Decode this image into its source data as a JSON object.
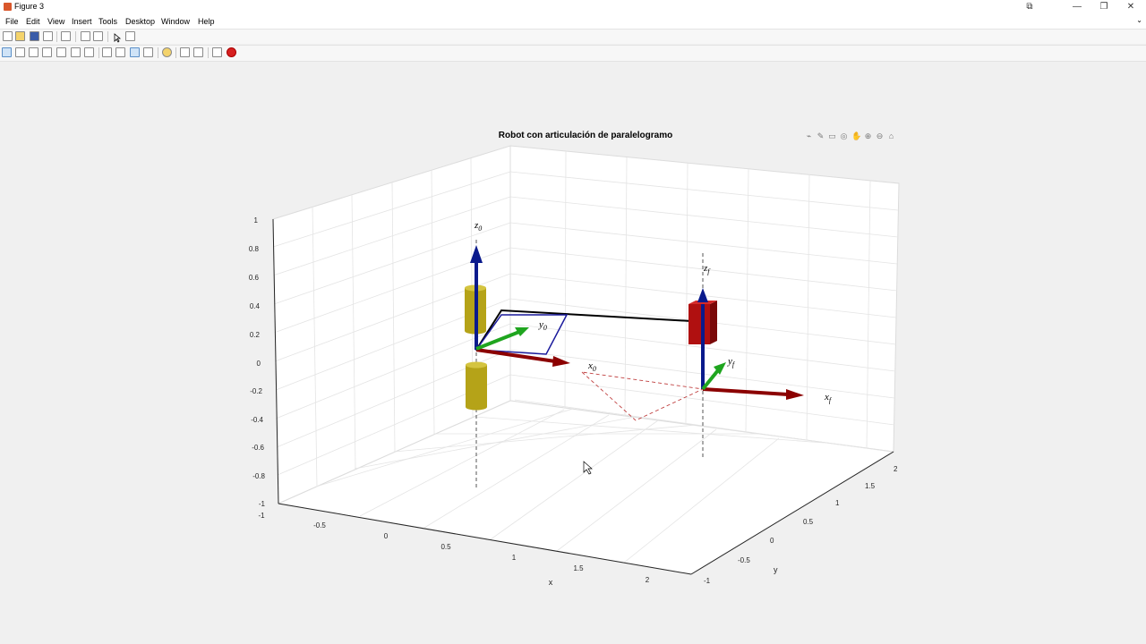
{
  "window": {
    "title": "Figure 3",
    "controls": [
      "⧉",
      "—",
      "❐",
      "✕"
    ]
  },
  "menu": {
    "items": [
      "File",
      "Edit",
      "View",
      "Insert",
      "Tools",
      "Desktop",
      "Window",
      "Help"
    ],
    "overflow": "⌄"
  },
  "plot": {
    "title": "Robot con articulación de paralelogramo",
    "xlabel": "x",
    "ylabel": "y",
    "zticks": [
      "1",
      "0.8",
      "0.6",
      "0.4",
      "0.2",
      "0",
      "-0.2",
      "-0.4",
      "-0.6",
      "-0.8",
      "-1"
    ],
    "xticks": [
      "-1",
      "-0.5",
      "0",
      "0.5",
      "1",
      "1.5",
      "2"
    ],
    "yticks": [
      "-1",
      "-0.5",
      "0",
      "0.5",
      "1",
      "1.5",
      "2"
    ],
    "frame_labels": {
      "z0_base": "z",
      "z0_sub": "0",
      "y0_base": "y",
      "y0_sub": "0",
      "x0_base": "x",
      "x0_sub": "0",
      "zf_base": "z",
      "zf_sub": "f",
      "yf_base": "y",
      "yf_sub": "f",
      "xf_base": "x",
      "xf_sub": "f"
    },
    "colors": {
      "x_axis": "#8b0000",
      "y_axis": "#1fa51f",
      "z_axis": "#0a1a8c",
      "link": "#000000",
      "parallelogram": "#1a1a9c",
      "joint_cylinder": "#b5a318",
      "end_block": "#b01010",
      "trace": "#c04040"
    }
  },
  "axes_toolbar_icons": [
    "brush-icon",
    "pen-icon",
    "data-tips-icon",
    "rotate-icon",
    "pan-icon",
    "zoom-in-icon",
    "zoom-out-icon",
    "home-icon"
  ]
}
